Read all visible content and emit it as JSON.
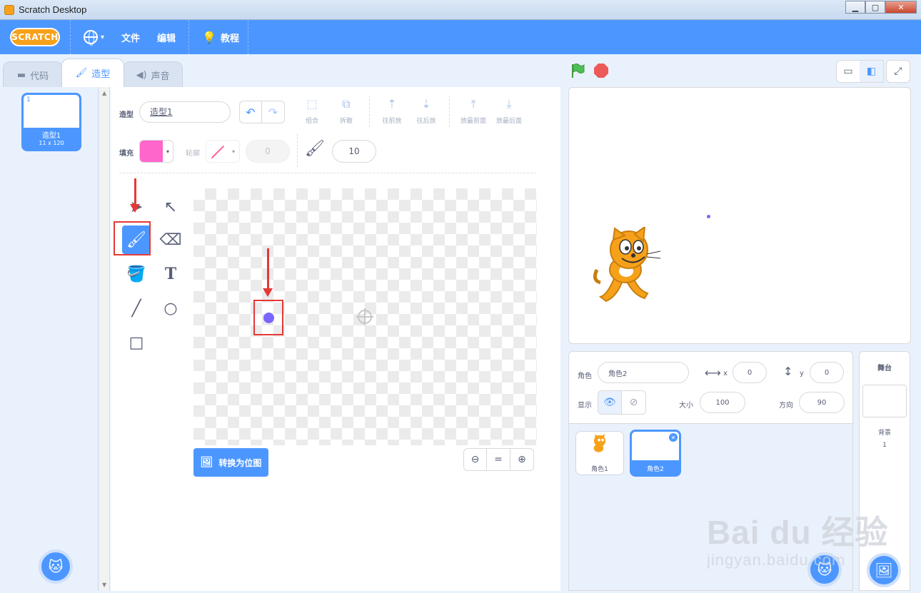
{
  "window": {
    "title": "Scratch Desktop",
    "minimize": "▁",
    "maximize": "▢",
    "close": "✕"
  },
  "menubar": {
    "logo": "SCRATCH",
    "file": "文件",
    "edit": "编辑",
    "tutorials": "教程"
  },
  "tabs": [
    {
      "label": "代码"
    },
    {
      "label": "造型"
    },
    {
      "label": "声音"
    }
  ],
  "costumes": [
    {
      "number": "1",
      "name": "造型1",
      "size": "11 x 120"
    }
  ],
  "editor": {
    "costume_label": "造型",
    "costume_name": "造型1",
    "group": "组合",
    "ungroup": "拆散",
    "forward": "往前放",
    "backward": "往后放",
    "front": "放最前面",
    "back": "放最后面",
    "fill_label": "填充",
    "fill_color": "#ff66cc",
    "outline_label": "轮廓",
    "outline_width": "0",
    "brush_size": "10",
    "convert_button": "转换为位图",
    "zoom_reset": "="
  },
  "sprite_info": {
    "sprite_label": "角色",
    "sprite_name": "角色2",
    "x_label": "x",
    "x_value": "0",
    "y_label": "y",
    "y_value": "0",
    "show_label": "显示",
    "size_label": "大小",
    "size_value": "100",
    "direction_label": "方向",
    "direction_value": "90"
  },
  "sprites": [
    {
      "name": "角色1"
    },
    {
      "name": "角色2"
    }
  ],
  "stage_pane": {
    "title": "舞台",
    "backdrop_label": "背景",
    "backdrop_count": "1"
  },
  "watermark": {
    "main": "Bai du 经验",
    "sub": "jingyan.baidu.com"
  },
  "colors": {
    "accent": "#4c97ff",
    "dot": "#7a66ff",
    "annotation": "#e53935"
  }
}
